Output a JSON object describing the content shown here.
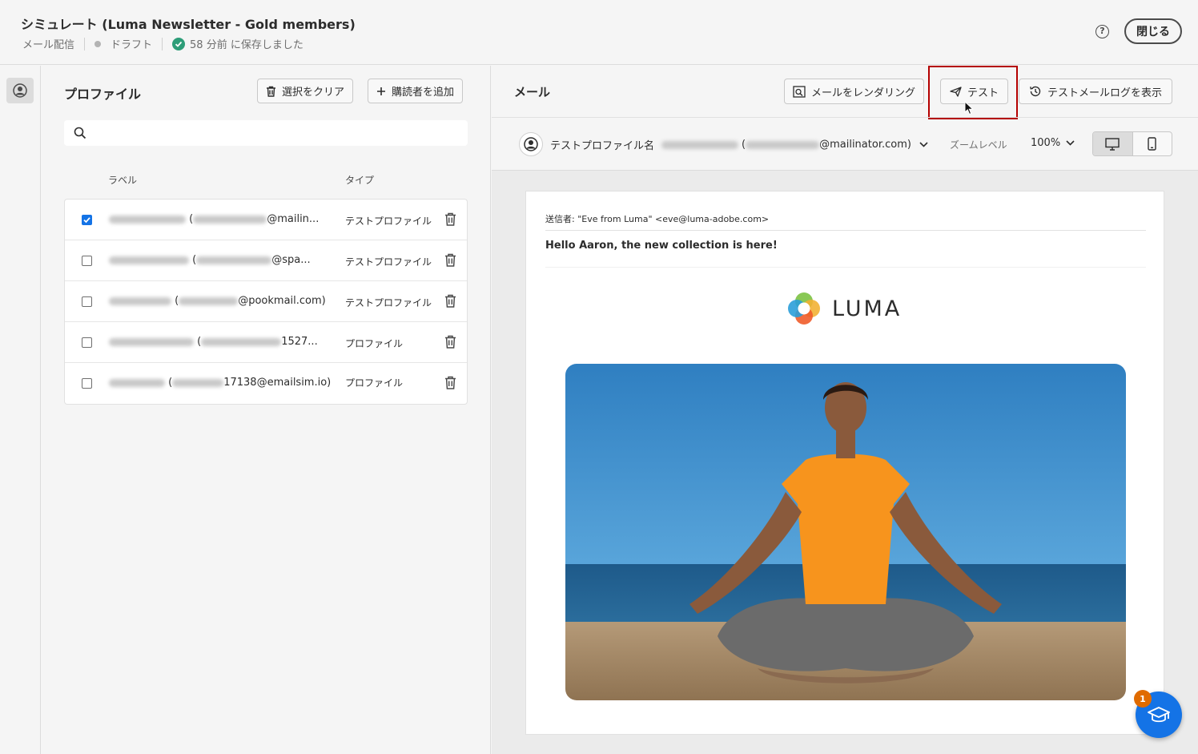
{
  "header": {
    "title": "シミュレート (Luma Newsletter - Gold members)",
    "channel": "メール配信",
    "status": "ドラフト",
    "saved": "58 分前 に保存しました",
    "close_label": "閉じる"
  },
  "profiles": {
    "title": "プロファイル",
    "clear_label": "選択をクリア",
    "add_label": "購読者を追加",
    "search_placeholder": "",
    "col_label": "ラベル",
    "col_type": "タイプ",
    "rows": [
      {
        "suffix": "@mailin...",
        "type": "テストプロファイル",
        "checked": true
      },
      {
        "suffix": "@spa...",
        "type": "テストプロファイル",
        "checked": false
      },
      {
        "suffix": "@pookmail.com)",
        "type": "テストプロファイル",
        "checked": false
      },
      {
        "suffix": "1527...",
        "type": "プロファイル",
        "checked": false
      },
      {
        "suffix": "17138@emailsim.io)",
        "type": "プロファイル",
        "checked": false
      }
    ]
  },
  "mail": {
    "title": "メール",
    "render_label": "メールをレンダリング",
    "test_label": "テスト",
    "log_label": "テストメールログを表示",
    "profile_label": "テストプロファイル名",
    "profile_email_suffix": "@mailinator.com)",
    "zoom_label": "ズームレベル",
    "zoom_value": "100%",
    "sender": "送信者: \"Eve from Luma\" <eve@luma-adobe.com>",
    "subject": "Hello Aaron, the new collection is here!",
    "logo_text": "LUMA"
  },
  "edu_badge": "1",
  "colors": {
    "accent": "#1473e6",
    "highlight": "#b40000",
    "saved_check": "#2d9d78",
    "badge": "#e06b00"
  }
}
